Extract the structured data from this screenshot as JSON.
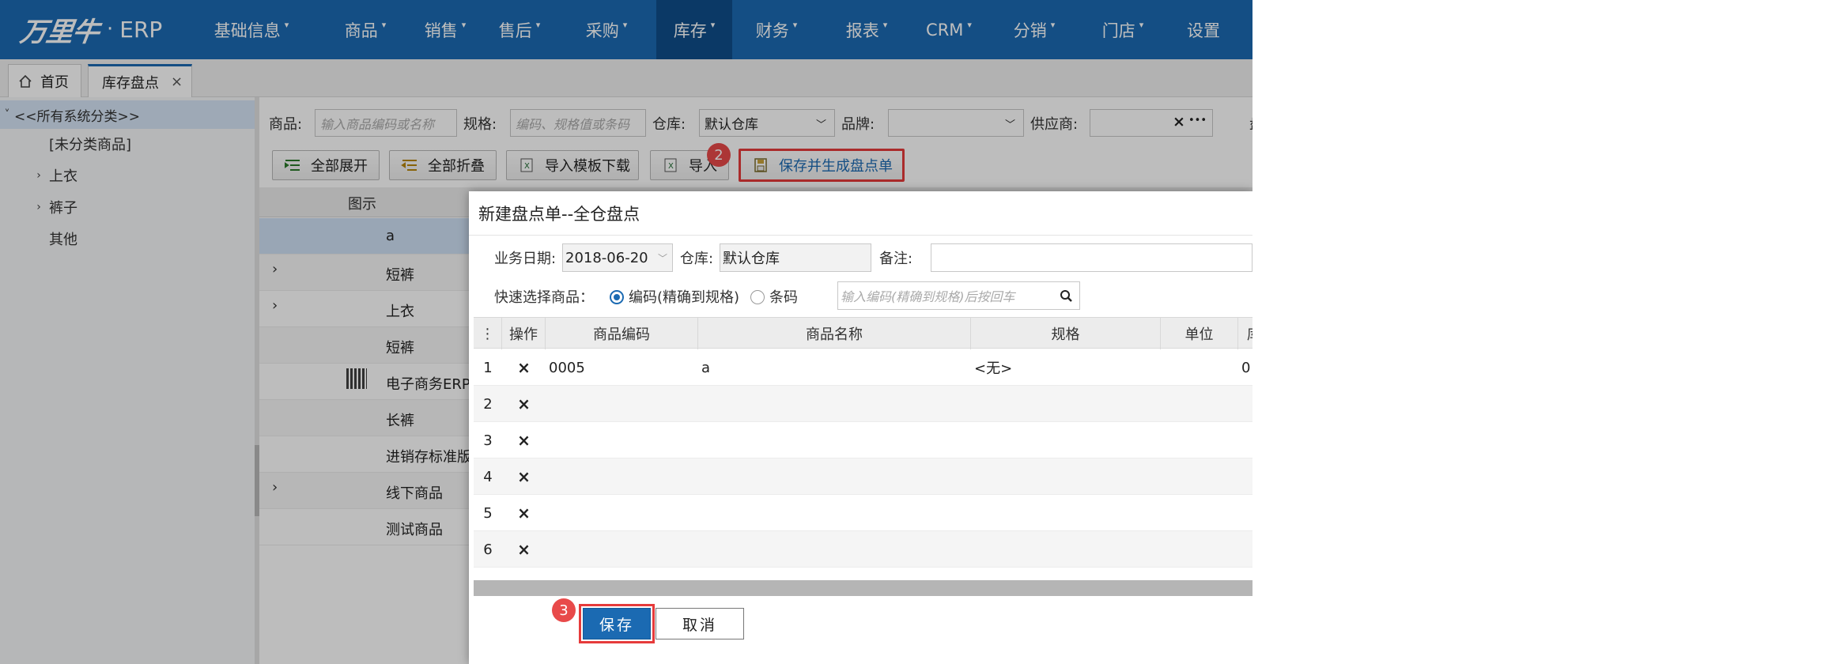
{
  "app": {
    "logo_mark": "万里牛",
    "logo_dot": "·",
    "logo_text": "ERP"
  },
  "nav": [
    {
      "label": "基础信息",
      "caret": true
    },
    {
      "label": "商品",
      "caret": true
    },
    {
      "label": "销售",
      "caret": true
    },
    {
      "label": "售后",
      "caret": true
    },
    {
      "label": "采购",
      "caret": true
    },
    {
      "label": "库存",
      "caret": true,
      "active": true
    },
    {
      "label": "财务",
      "caret": true
    },
    {
      "label": "报表",
      "caret": true
    },
    {
      "label": "CRM",
      "caret": true
    },
    {
      "label": "分销",
      "caret": true
    },
    {
      "label": "门店",
      "caret": true
    },
    {
      "label": "设置",
      "caret": false
    }
  ],
  "tabs": {
    "home": "首页",
    "active": "库存盘点",
    "close": "×"
  },
  "sidebar": {
    "root": "<<所有系统分类>>",
    "items": [
      "[未分类商品]",
      "上衣",
      "裤子",
      "其他"
    ]
  },
  "filters": {
    "product_label": "商品:",
    "product_placeholder": "输入商品编码或名称",
    "spec_label": "规格:",
    "spec_placeholder": "编码、规格值或条码",
    "warehouse_label": "仓库:",
    "warehouse_value": "默认仓库",
    "brand_label": "品牌:",
    "brand_value": "",
    "supplier_label": "供应商:",
    "supplier_clear": "×",
    "supplier_more": "•••",
    "cutoff_label": "盘"
  },
  "toolbar": {
    "expand_all": "全部展开",
    "collapse_all": "全部折叠",
    "download_template": "导入模板下载",
    "import": "导入",
    "save_generate": "保存并生成盘点单",
    "badge_2": "2",
    "badge_3": "3"
  },
  "background_grid": {
    "header_image": "图示",
    "rows": [
      "a",
      "短裤",
      "上衣",
      "短裤",
      "电子商务ERP",
      "长裤",
      "进销存标准版",
      "线下商品",
      "测试商品"
    ],
    "expander": "›"
  },
  "modal": {
    "title": "新建盘点单--全仓盘点",
    "date_label": "业务日期:",
    "date_value": "2018-06-20",
    "warehouse_label": "仓库:",
    "warehouse_value": "默认仓库",
    "remark_label": "备注:",
    "remark_value": "",
    "quick_label": "快速选择商品：",
    "radio_code": "编码(精确到规格)",
    "radio_barcode": "条码",
    "search_placeholder": "输入编码(精确到规格)后按回车",
    "columns": [
      "操作",
      "商品编码",
      "商品名称",
      "规格",
      "单位",
      "库"
    ],
    "rows": [
      {
        "no": "1",
        "op": "×",
        "code": "0005",
        "name": "a",
        "spec": "<无>",
        "unit": "",
        "stock": "0"
      },
      {
        "no": "2",
        "op": "×",
        "code": "",
        "name": "",
        "spec": "",
        "unit": "",
        "stock": ""
      },
      {
        "no": "3",
        "op": "×",
        "code": "",
        "name": "",
        "spec": "",
        "unit": "",
        "stock": ""
      },
      {
        "no": "4",
        "op": "×",
        "code": "",
        "name": "",
        "spec": "",
        "unit": "",
        "stock": ""
      },
      {
        "no": "5",
        "op": "×",
        "code": "",
        "name": "",
        "spec": "",
        "unit": "",
        "stock": ""
      },
      {
        "no": "6",
        "op": "×",
        "code": "",
        "name": "",
        "spec": "",
        "unit": "",
        "stock": ""
      }
    ],
    "save": "保存",
    "cancel": "取消"
  },
  "colors": {
    "brand": "#1b6ab2",
    "highlight": "#e63b3b",
    "nav_active": "#0f4d8a"
  }
}
